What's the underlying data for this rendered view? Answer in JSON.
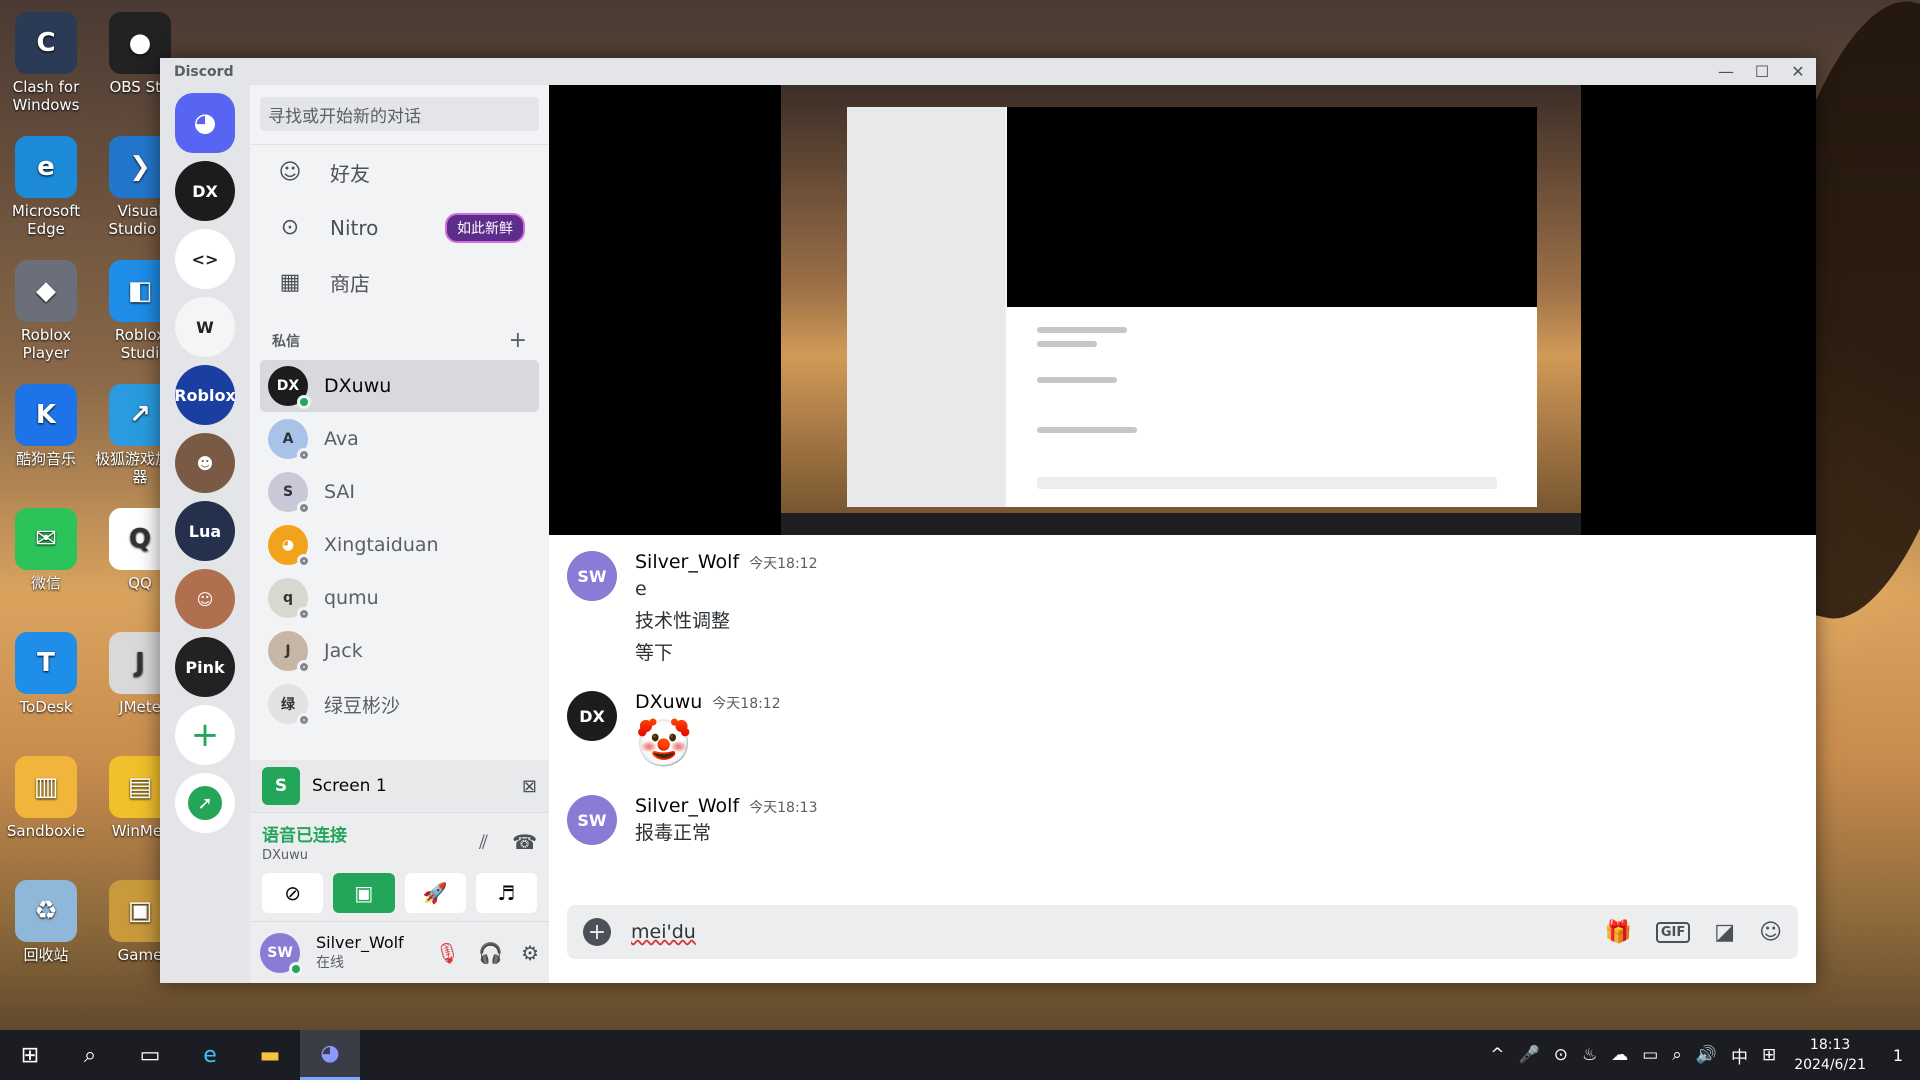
{
  "desktop": {
    "icons": [
      {
        "label": "Clash for Windows",
        "color": "#2b3a55",
        "glyph": "C"
      },
      {
        "label": "OBS Stu",
        "color": "#222222",
        "glyph": "●"
      },
      {
        "label": "Microsoft Edge",
        "color": "#1d8ad8",
        "glyph": "e"
      },
      {
        "label": "Visual Studio C",
        "color": "#2277cc",
        "glyph": "❯"
      },
      {
        "label": "Roblox Player",
        "color": "#6b6f7a",
        "glyph": "◆"
      },
      {
        "label": "Roblox Studi",
        "color": "#1e8ee8",
        "glyph": "◧"
      },
      {
        "label": "酷狗音乐",
        "color": "#1d74e8",
        "glyph": "K"
      },
      {
        "label": "极狐游戏加速器",
        "color": "#2a9be0",
        "glyph": "↗"
      },
      {
        "label": "微信",
        "color": "#2cc35b",
        "glyph": "✉"
      },
      {
        "label": "QQ",
        "color": "#ffffff",
        "glyph": "Q"
      },
      {
        "label": "ToDesk",
        "color": "#1e8ee8",
        "glyph": "T"
      },
      {
        "label": "JMete",
        "color": "#d9d9d9",
        "glyph": "J"
      },
      {
        "label": "Sandboxie",
        "color": "#f2b53b",
        "glyph": "▥"
      },
      {
        "label": "WinMer",
        "color": "#f2c02b",
        "glyph": "▤"
      },
      {
        "label": "回收站",
        "color": "#8fb7d9",
        "glyph": "♻"
      },
      {
        "label": "Game",
        "color": "#c89a3c",
        "glyph": "▣"
      }
    ]
  },
  "window": {
    "title": "Discord",
    "minimize": "—",
    "maximize": "☐",
    "close": "✕"
  },
  "servers": {
    "home_glyph": "◕",
    "items": [
      {
        "name": "DX",
        "color": "#1c1c1c"
      },
      {
        "name": "<>",
        "color": "#ffffff"
      },
      {
        "name": "W",
        "color": "#f5f5f5"
      },
      {
        "name": "Roblox",
        "color": "#1b3fa0"
      },
      {
        "name": "☻",
        "color": "#7a5a45"
      },
      {
        "name": "Lua",
        "color": "#24304c"
      },
      {
        "name": "☺",
        "color": "#b07050"
      },
      {
        "name": "Pink",
        "color": "#222222"
      }
    ],
    "add_glyph": "+",
    "explore_glyph": "➚"
  },
  "dm_sidebar": {
    "search_placeholder": "寻找或开始新的对话",
    "nav": [
      {
        "label": "好友",
        "icon": "friends-icon",
        "glyph": "☺"
      },
      {
        "label": "Nitro",
        "icon": "nitro-icon",
        "glyph": "⊙",
        "badge": "如此新鲜"
      },
      {
        "label": "商店",
        "icon": "shop-icon",
        "glyph": "▦"
      }
    ],
    "dm_header": "私信",
    "dm_add": "+",
    "dms": [
      {
        "name": "DXuwu",
        "status": "online",
        "color": "#1c1c1c",
        "initials": "DX",
        "active": true
      },
      {
        "name": "Ava",
        "status": "offline",
        "color": "#a9c3e8",
        "initials": "A",
        "active": false
      },
      {
        "name": "SAI",
        "status": "offline",
        "color": "#c8c8d8",
        "initials": "S",
        "active": false
      },
      {
        "name": "Xingtaiduan",
        "status": "offline",
        "color": "#f2a31b",
        "initials": "◕",
        "active": false
      },
      {
        "name": "qumu",
        "status": "offline",
        "color": "#d8d8d0",
        "initials": "q",
        "active": false
      },
      {
        "name": "Jack",
        "status": "offline",
        "color": "#c7b6a6",
        "initials": "J",
        "active": false
      },
      {
        "name": "绿豆彬沙",
        "status": "offline",
        "color": "#e2e2e2",
        "initials": "绿",
        "active": false
      }
    ],
    "screen_share": {
      "initial": "S",
      "label": "Screen 1",
      "close": "⊠"
    },
    "voice": {
      "status": "语音已连接",
      "channel": "DXuwu",
      "icons": [
        "⫽",
        "☎"
      ],
      "buttons": [
        {
          "name": "camera-off-button",
          "glyph": "⊘"
        },
        {
          "name": "screen-share-button",
          "glyph": "▣"
        },
        {
          "name": "activity-button",
          "glyph": "🚀"
        },
        {
          "name": "soundboard-button",
          "glyph": "♬"
        }
      ]
    },
    "user": {
      "name": "Silver_Wolf",
      "status": "在线",
      "mic": "🎙",
      "headset": "🎧",
      "settings": "⚙"
    }
  },
  "chat": {
    "messages": [
      {
        "author": "Silver_Wolf",
        "time": "今天18:12",
        "color": "#8b7ad6",
        "initials": "SW",
        "lines": [
          "e",
          "技术性调整",
          "等下"
        ]
      },
      {
        "author": "DXuwu",
        "time": "今天18:12",
        "color": "#1c1c1c",
        "initials": "DX",
        "lines": [
          "🤡"
        ]
      },
      {
        "author": "Silver_Wolf",
        "time": "今天18:13",
        "color": "#8b7ad6",
        "initials": "SW",
        "lines": [
          "报毒正常"
        ]
      }
    ],
    "composer": {
      "text": "mei'du",
      "plus": "+",
      "gif": "GIF",
      "gift": "🎁",
      "sticker": "◪",
      "emoji": "☺"
    }
  },
  "taskbar": {
    "start": "⊞",
    "search": "⌕",
    "taskview": "▭",
    "apps": [
      {
        "name": "edge",
        "glyph": "e"
      },
      {
        "name": "explorer",
        "glyph": "▬"
      },
      {
        "name": "discord",
        "glyph": "◕"
      }
    ],
    "tray": [
      "^",
      "🎤",
      "⊙",
      "♨",
      "☁",
      "▭",
      "⌕",
      "🔊",
      "中",
      "⊞"
    ],
    "time": "18:13",
    "date": "2024/6/21",
    "notifications": "1"
  },
  "colors": {
    "accent": "#5865f2",
    "online": "#23a55a",
    "danger": "#da373c",
    "nitro_badge": "#5e2d8c"
  }
}
